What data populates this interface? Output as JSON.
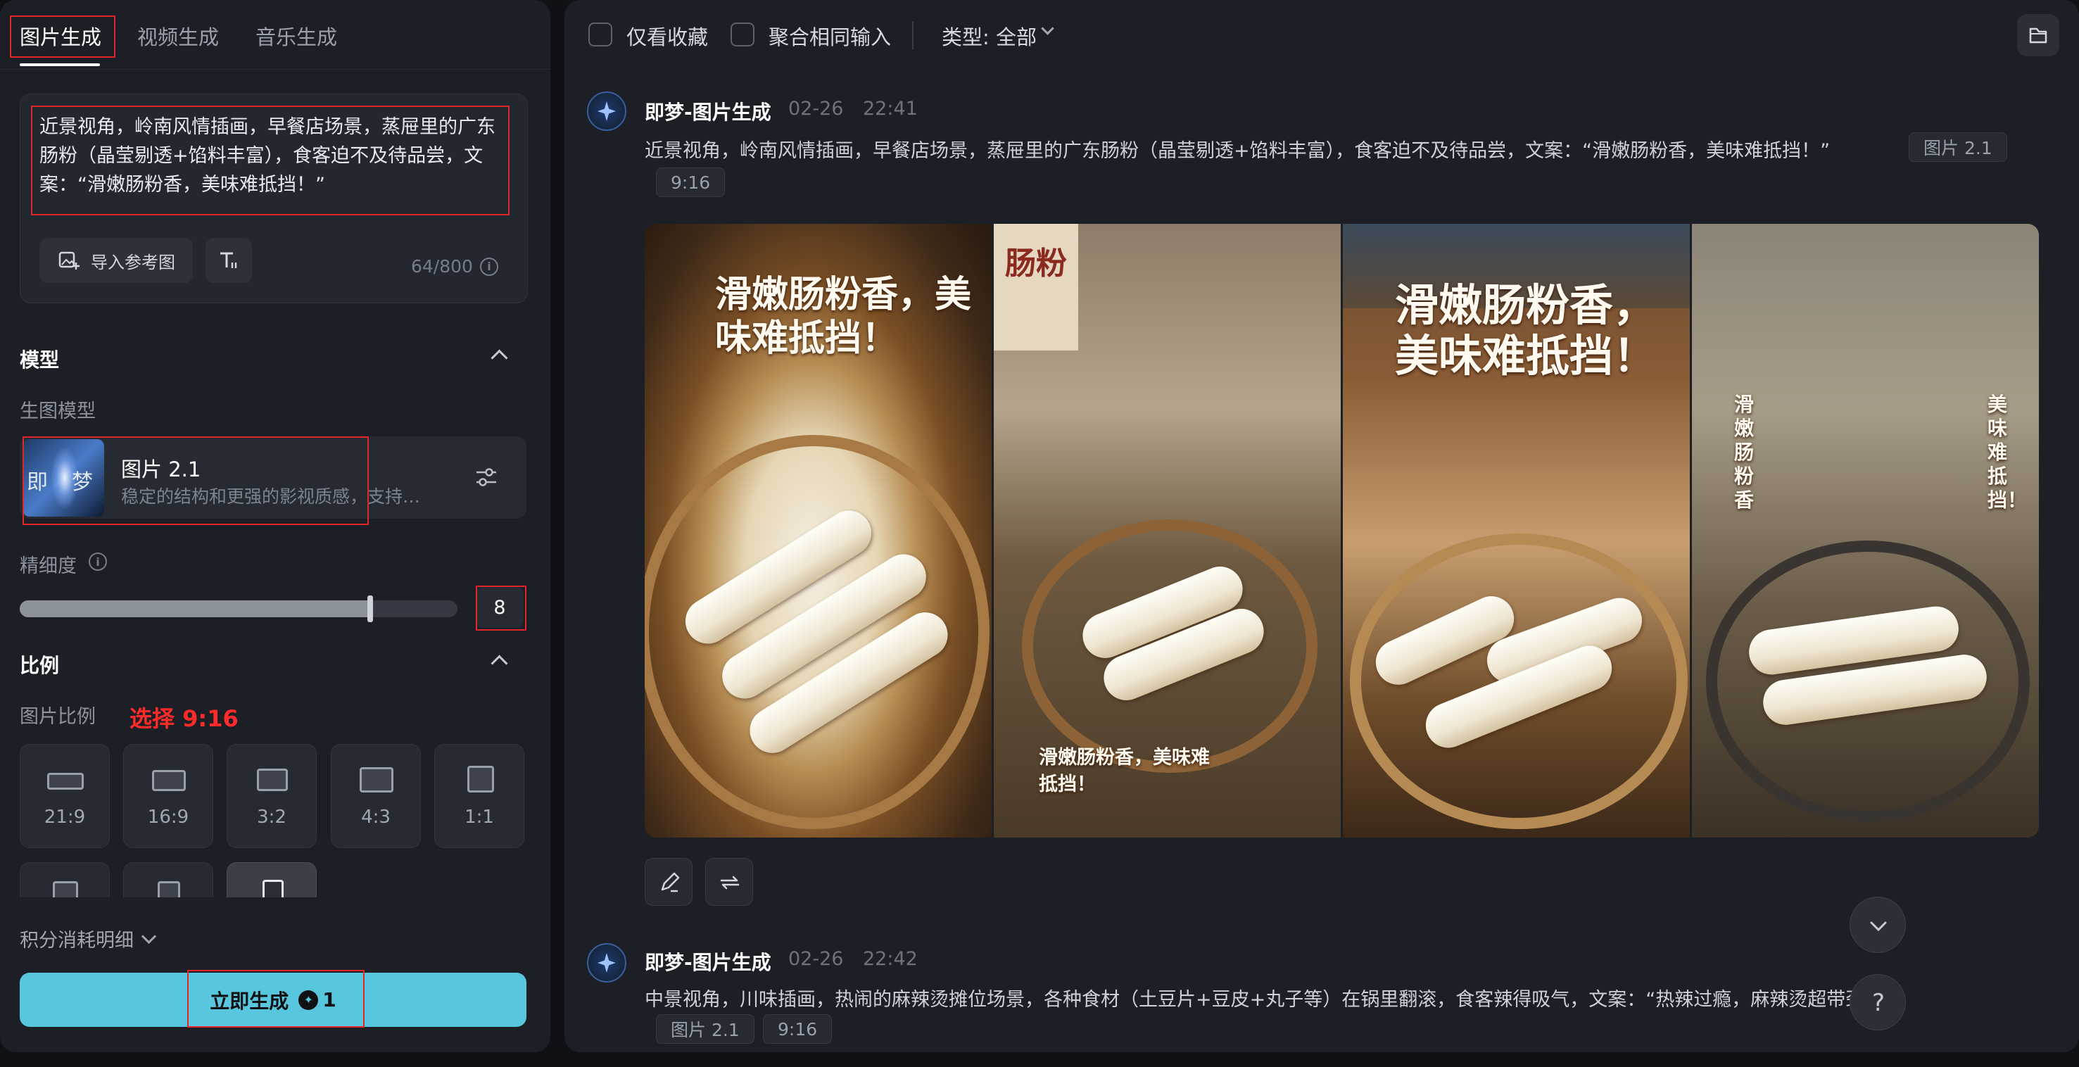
{
  "tabs": [
    {
      "label": "图片生成",
      "active": true
    },
    {
      "label": "视频生成",
      "active": false
    },
    {
      "label": "音乐生成",
      "active": false
    }
  ],
  "prompt": {
    "text": "近景视角，岭南风情插画，早餐店场景，蒸屉里的广东肠粉（晶莹剔透+馅料丰富），食客迫不及待品尝，文案：“滑嫩肠粉香，美味难抵挡！”",
    "import_ref_label": "导入参考图",
    "counter": "64/800"
  },
  "model_section": {
    "title": "模型",
    "sub_label": "生图模型",
    "model_name": "图片 2.1",
    "model_desc": "稳定的结构和更强的影视质感，支持…",
    "thumb_text": [
      "即",
      "梦"
    ],
    "detail_label": "精细度",
    "detail_value": "8",
    "detail_level": 8,
    "detail_max": 10
  },
  "ratio_section": {
    "title": "比例",
    "sub_label": "图片比例",
    "annotation": "选择 9:16",
    "options": [
      "21:9",
      "16:9",
      "3:2",
      "4:3",
      "1:1"
    ]
  },
  "credits_label": "积分消耗明细",
  "generate": {
    "label": "立即生成",
    "cost": "1"
  },
  "toolbar": {
    "favorites_label": "仅看收藏",
    "merge_label": "聚合相同输入",
    "type_label": "类型: 全部"
  },
  "messages": [
    {
      "name": "即梦-图片生成",
      "date": "02-26",
      "time": "22:41",
      "text": "近景视角，岭南风情插画，早餐店场景，蒸屉里的广东肠粉（晶莹剔透+馅料丰富），食客迫不及待品尝，文案：“滑嫩肠粉香，美味难抵挡！”",
      "model_tag": "图片 2.1",
      "ratio_tag": "9:16",
      "images": [
        {
          "caption": "滑嫩肠粉香，美味难抵挡！"
        },
        {
          "caption": "滑嫩肠粉香，美味难抵挡！",
          "sign": "肠粉"
        },
        {
          "caption": "滑嫩肠粉香，美味难抵挡！"
        },
        {
          "caption_a": "滑嫩肠粉香",
          "caption_b": "美味难抵挡！"
        }
      ]
    },
    {
      "name": "即梦-图片生成",
      "date": "02-26",
      "time": "22:42",
      "text": "中景视角，川味插画，热闹的麻辣烫摊位场景，各种食材（土豆片+豆皮+丸子等）在锅里翻滚，食客辣得吸气，文案：“热辣过瘾，麻辣烫超带劲！”",
      "model_tag": "图片 2.1",
      "ratio_tag": "9:16"
    }
  ],
  "colors": {
    "accent": "#58c6dc",
    "annotation_red": "#e3262b"
  }
}
